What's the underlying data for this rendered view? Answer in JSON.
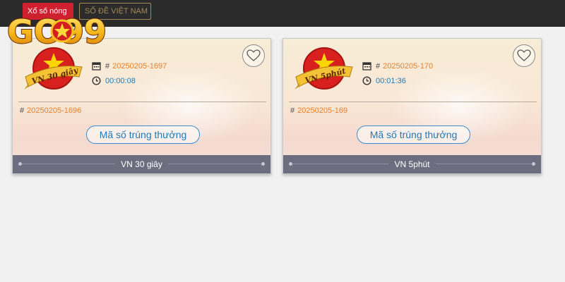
{
  "nav": {
    "live_label": "Xổ số nóng",
    "vn_label": "SỐ ĐỀ VIỆT NAM"
  },
  "logo": {
    "text": "GO99"
  },
  "cards": [
    {
      "badge_text": "VN 30 giây",
      "issue": "20250205-1697",
      "countdown": "00:00:08",
      "previous_issue": "20250205-1696",
      "button_label": "Mã số trúng thưởng",
      "footer_title": "VN 30 giây"
    },
    {
      "badge_text": "VN 5phút",
      "issue": "20250205-170",
      "countdown": "00:01:36",
      "previous_issue": "20250205-169",
      "button_label": "Mã số trúng thưởng",
      "footer_title": "VN 5phút"
    }
  ],
  "symbols": {
    "hash": "#"
  },
  "colors": {
    "accent_orange": "#e87f2a",
    "link_blue": "#2478b5",
    "live_red": "#cf2030",
    "footer_gray": "#6c6e7f"
  },
  "icons": [
    "calendar-icon",
    "clock-icon",
    "heart-icon",
    "vietnam-flag-badge"
  ]
}
